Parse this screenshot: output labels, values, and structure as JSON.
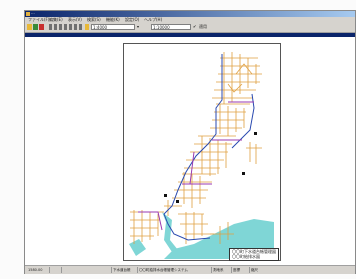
{
  "window": {
    "title": "..."
  },
  "menu": {
    "items": [
      "ファイル(F)",
      "編集(E)",
      "表示(V)",
      "検索(S)",
      "機能(K)",
      "設定(O)",
      "ヘルプ(H)"
    ]
  },
  "toolbar": {
    "scale_value": "1:4000",
    "layer_value": "1:10000",
    "apply_label": "適用"
  },
  "document_tab": {
    "label": ""
  },
  "legend": {
    "line1": "〇〇町下水道台帳管理図",
    "line2": "〇〇町給排水図"
  },
  "status": {
    "items": [
      "1580.00",
      "",
      "",
      "下水道台帳",
      "〇〇町給排水台帳管理システム",
      "測地系",
      "座標",
      "縮尺"
    ]
  },
  "colors": {
    "titlebar": "#0a246a",
    "orange_pipes": "#e0a040",
    "blue_mains": "#2a4ab0",
    "purple_mains": "#9a3ab0",
    "water": "#7fd6d6"
  }
}
